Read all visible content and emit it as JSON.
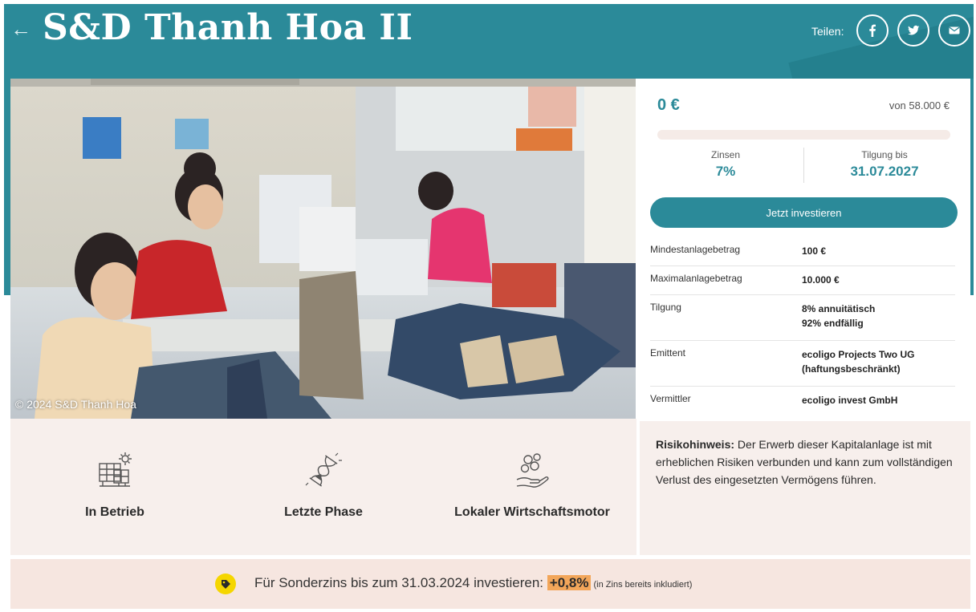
{
  "header": {
    "title": "S&D Thanh Hoa II",
    "share_label": "Teilen:"
  },
  "photo": {
    "credit": "© 2024 S&D Thanh Hoa"
  },
  "funding": {
    "amount": "0 €",
    "target": "von 58.000 €",
    "progress_fraction": 0,
    "interest_label": "Zinsen",
    "interest_value": "7%",
    "repayment_label": "Tilgung bis",
    "repayment_value": "31.07.2027",
    "invest_button": "Jetzt investieren"
  },
  "facts": [
    {
      "key": "Mindestanlagebetrag",
      "value": "100 €"
    },
    {
      "key": "Maximalanlagebetrag",
      "value": "10.000 €"
    },
    {
      "key": "Tilgung",
      "value": "8% annuitätisch\n92% endfällig"
    },
    {
      "key": "Emittent",
      "value": "ecoligo Projects Two UG (haftungsbeschränkt)"
    },
    {
      "key": "Vermittler",
      "value": "ecoligo invest GmbH"
    }
  ],
  "features": [
    {
      "label": "In Betrieb",
      "icon": "solar-panel-icon"
    },
    {
      "label": "Letzte Phase",
      "icon": "hourglass-icon"
    },
    {
      "label": "Lokaler Wirtschaftsmotor",
      "icon": "coins-hand-icon"
    }
  ],
  "risk": {
    "heading": "Risikohinweis:",
    "text": " Der Erwerb dieser Kapitalanlage ist mit erheblichen Risiken verbunden und kann zum vollständigen Verlust des eingesetzten Vermögens führen."
  },
  "promo": {
    "text": "Für Sonderzins bis zum 31.03.2024 investieren: ",
    "highlight": "+0,8%",
    "note": " (in Zins bereits inkludiert)"
  },
  "colors": {
    "brand": "#2b8a99",
    "beige": "#f7efec",
    "promo_bg": "#f6e6e0",
    "highlight": "#f2a65a",
    "tag_yellow": "#f5d600"
  }
}
